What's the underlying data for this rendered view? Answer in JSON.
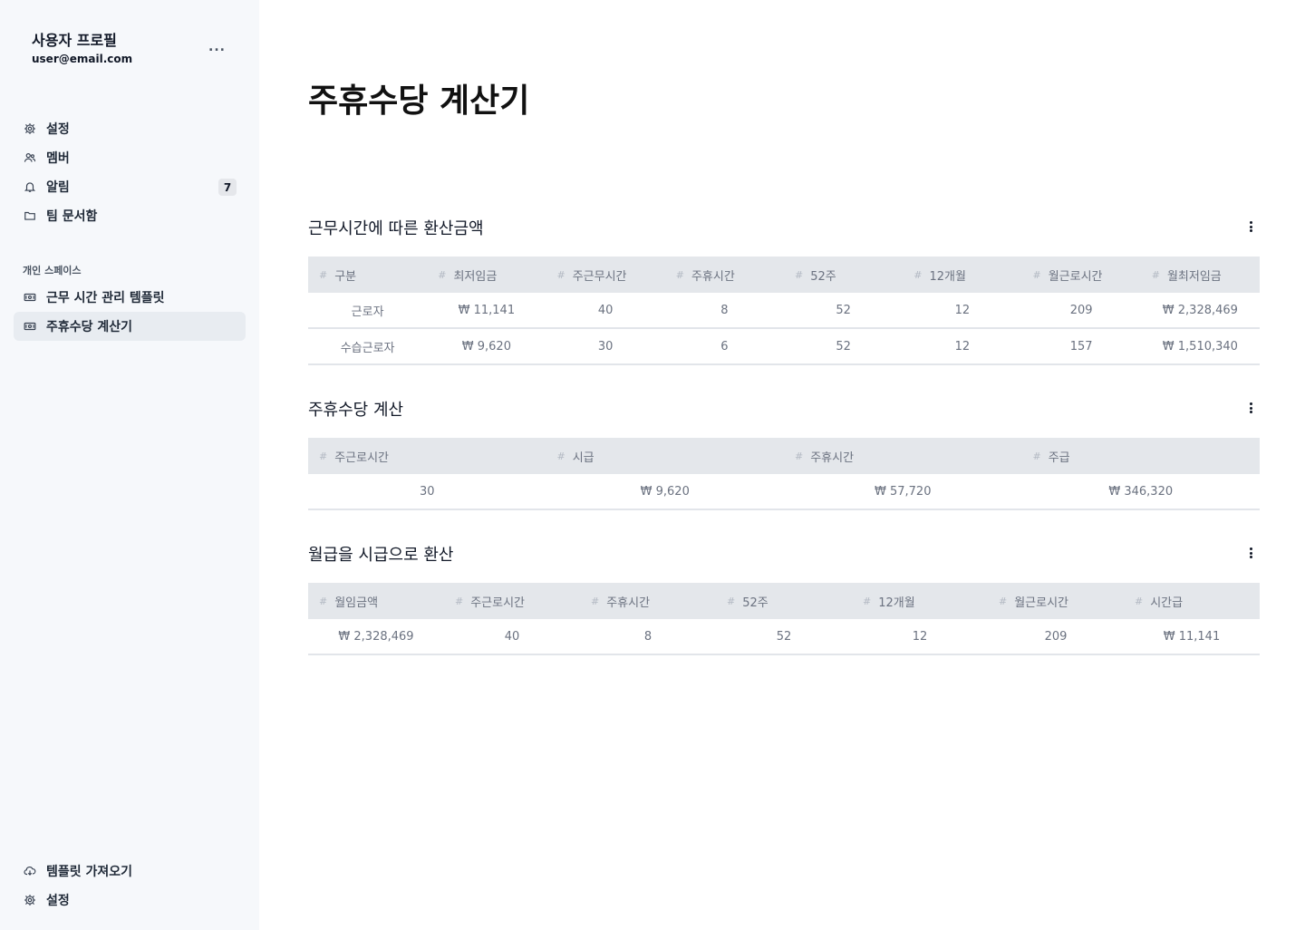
{
  "profile": {
    "name": "사용자 프로필",
    "email": "user@email.com",
    "more": "..."
  },
  "nav": {
    "items": [
      {
        "label": "설정",
        "icon": "gear-icon"
      },
      {
        "label": "멤버",
        "icon": "users-icon"
      },
      {
        "label": "알림",
        "icon": "bell-icon",
        "badge": "7"
      },
      {
        "label": "팀 문서함",
        "icon": "folder-icon"
      }
    ],
    "section_label": "개인 스페이스",
    "space_items": [
      {
        "label": "근무 시간 관리 템플릿",
        "icon": "money-icon"
      },
      {
        "label": "주휴수당 계산기",
        "icon": "money-icon",
        "active": true
      }
    ],
    "bottom_items": [
      {
        "label": "템플릿 가져오기",
        "icon": "cloud-download-icon"
      },
      {
        "label": "설정",
        "icon": "gear-icon"
      }
    ]
  },
  "page": {
    "title": "주휴수당 계산기"
  },
  "tables": [
    {
      "title": "근무시간에 따른 환산금액",
      "columns": [
        "구분",
        "최저임금",
        "주근무시간",
        "주휴시간",
        "52주",
        "12개월",
        "월근로시간",
        "월최저임금"
      ],
      "rows": [
        [
          "근로자",
          "₩ 11,141",
          "40",
          "8",
          "52",
          "12",
          "209",
          "₩ 2,328,469"
        ],
        [
          "수습근로자",
          "₩ 9,620",
          "30",
          "6",
          "52",
          "12",
          "157",
          "₩ 1,510,340"
        ]
      ]
    },
    {
      "title": "주휴수당 계산",
      "columns": [
        "주근로시간",
        "시급",
        "주휴시간",
        "주급"
      ],
      "rows": [
        [
          "30",
          "₩ 9,620",
          "₩ 57,720",
          "₩ 346,320"
        ]
      ]
    },
    {
      "title": "월급을 시급으로 환산",
      "columns": [
        "월임금액",
        "주근로시간",
        "주휴시간",
        "52주",
        "12개월",
        "월근로시간",
        "시간급"
      ],
      "rows": [
        [
          "₩ 2,328,469",
          "40",
          "8",
          "52",
          "12",
          "209",
          "₩ 11,141"
        ]
      ]
    }
  ],
  "colors": {
    "sidebar_bg": "#f6f8fb",
    "active_bg": "#e8ecf1",
    "header_bg": "#e4e7eb"
  }
}
